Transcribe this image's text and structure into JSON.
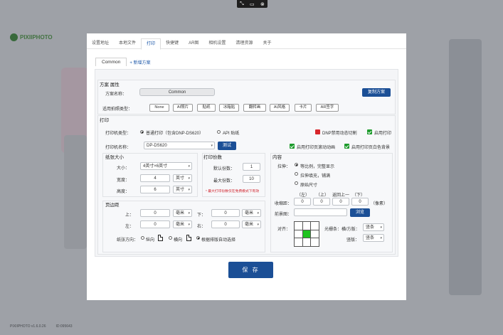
{
  "topbar": {
    "icons": [
      "collapse-icon",
      "screen-icon",
      "close-icon"
    ],
    "glyphs": [
      "⤡",
      "▭",
      "⊗"
    ]
  },
  "brand": {
    "name": "PIXIIPHOTO"
  },
  "tabs": [
    "设置地址",
    "本地文件",
    "打印",
    "快捷键",
    "AR图",
    "相机设置",
    "清理资源",
    "关于"
  ],
  "active_tab": "打印",
  "scheme_tabs": {
    "current": "Common",
    "add": "+ 新增方案"
  },
  "scheme": {
    "section_title": "方案 属性",
    "name_label": "方案名称：",
    "name_value": "Common",
    "copy_button": "复制方案",
    "types_label": "适用拍照类型：",
    "types": [
      "None",
      "AI照片",
      "贴纸",
      "冰箱贴",
      "翻转画",
      "AI风格",
      "卡片",
      "AR签字"
    ]
  },
  "print": {
    "section_title": "打印",
    "printer_type_label": "打印机类型：",
    "options": [
      "普通打印（包含DNP-DS620）",
      "API 贴纸"
    ],
    "dnp_cut": "DNP禁用动态切割",
    "enable_print": "启用打印",
    "printer_name_label": "打印机名称：",
    "printer_name": "DP-DS620",
    "test_button": "测试",
    "scroll_anim": "启用打印页滚动动画",
    "white_bg": "启用打印页白色背景"
  },
  "paper": {
    "section_title": "纸张大小",
    "size_label": "大小：",
    "size_value": "4英寸×6英寸",
    "width_label": "宽度：",
    "width_value": "4",
    "width_unit": "英寸",
    "height_label": "高度：",
    "height_value": "6",
    "height_unit": "英寸"
  },
  "copies": {
    "section_title": "打印份数",
    "default_label": "默认份数：",
    "default_value": "1",
    "max_label": "最大份数：",
    "max_value": "10",
    "hint": "* 最大打印份数仅在免费模式下有效"
  },
  "content": {
    "section_title": "内容",
    "stretch_label": "拉伸：",
    "stretch_options": [
      "等比例，完整显示",
      "拉伸填充，铺满",
      "原始尺寸"
    ],
    "margin_headers": [
      "（左）",
      "（上）",
      "返回上一",
      "（下）"
    ],
    "shrink_label": "收缩距：",
    "shrink_values": [
      "0",
      "0",
      "0",
      "0"
    ],
    "shrink_unit": "（像素）",
    "fg_label": "前景图：",
    "browse_button": "浏览",
    "align_label": "对齐：",
    "light_label": "光栅条：横/方版：",
    "light_value": "竖条",
    "vert_label": "竖版：",
    "vert_value": "竖条"
  },
  "margins": {
    "section_title": "页边距",
    "top_label": "上：",
    "top_value": "0",
    "top_unit": "毫米",
    "bottom_label": "下：",
    "bottom_value": "0",
    "bottom_unit": "毫米",
    "left_label": "左：",
    "left_value": "0",
    "left_unit": "毫米",
    "right_label": "右：",
    "right_value": "0",
    "right_unit": "毫米",
    "orient_label": "纸张方向：",
    "orient_options": [
      "纵向",
      "横向",
      "根据排版自动选择"
    ]
  },
  "save_button": "保 存",
  "status": [
    "PIXIIPHOTO v1.6.0.26",
    "ID:095643"
  ]
}
